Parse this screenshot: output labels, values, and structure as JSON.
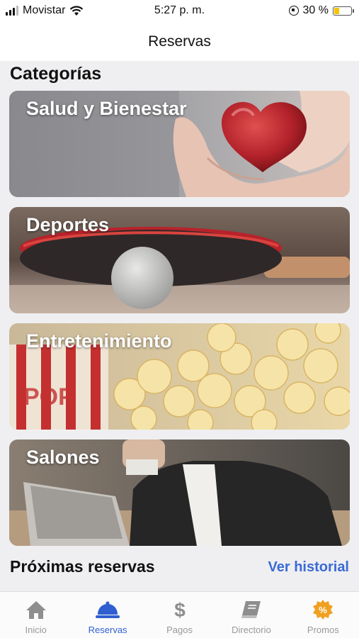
{
  "status_bar": {
    "carrier": "Movistar",
    "time": "5:27 p. m.",
    "battery_percent": "30 %",
    "battery_level": 0.3
  },
  "nav": {
    "title": "Reservas"
  },
  "categories": {
    "heading": "Categorías",
    "items": [
      {
        "label": "Salud y Bienestar",
        "image": "heart-hands"
      },
      {
        "label": "Deportes",
        "image": "ping-pong"
      },
      {
        "label": "Entretenimiento",
        "image": "popcorn"
      },
      {
        "label": "Salones",
        "image": "business-meeting"
      }
    ]
  },
  "upcoming": {
    "heading": "Próximas reservas",
    "history_link": "Ver historial"
  },
  "tab_bar": {
    "items": [
      {
        "label": "Inicio",
        "icon": "home-icon",
        "active": false
      },
      {
        "label": "Reservas",
        "icon": "bell-icon",
        "active": true
      },
      {
        "label": "Pagos",
        "icon": "dollar-icon",
        "active": false
      },
      {
        "label": "Directorio",
        "icon": "book-icon",
        "active": false
      },
      {
        "label": "Promos",
        "icon": "promo-badge-icon",
        "active": false
      }
    ]
  },
  "colors": {
    "accent": "#2f5fd0",
    "link": "#3a6ad6",
    "promo": "#f0a020",
    "inactive": "#999999"
  }
}
